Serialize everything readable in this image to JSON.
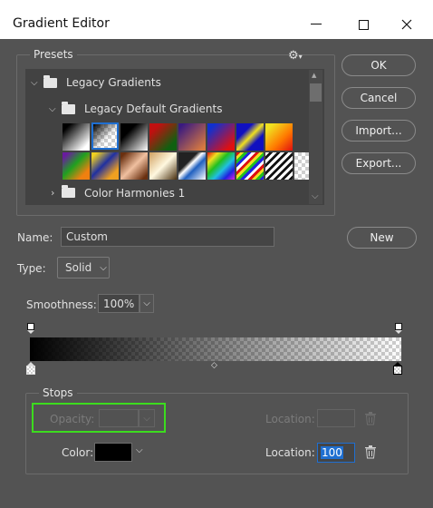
{
  "window": {
    "title": "Gradient Editor"
  },
  "presets": {
    "legend": "Presets",
    "tree": [
      {
        "label": "Legacy Gradients"
      },
      {
        "label": "Legacy Default Gradients"
      },
      {
        "label": "Color Harmonies 1"
      }
    ]
  },
  "buttons": {
    "ok": "OK",
    "cancel": "Cancel",
    "import": "Import...",
    "export": "Export...",
    "new": "New"
  },
  "name": {
    "label": "Name:",
    "value": "Custom"
  },
  "type": {
    "label": "Type:",
    "value": "Solid"
  },
  "smoothness": {
    "label": "Smoothness:",
    "value": "100%"
  },
  "stops": {
    "legend": "Stops",
    "opacity_label": "Opacity:",
    "opacity_value": "",
    "location_label_dim": "Location:",
    "location_dim_value": "",
    "color_label": "Color:",
    "location_label": "Location:",
    "location_value": "100"
  },
  "colors": {
    "highlight": "#3cdc1e",
    "selection": "#1f6fd1",
    "color_stop": "#000000"
  }
}
